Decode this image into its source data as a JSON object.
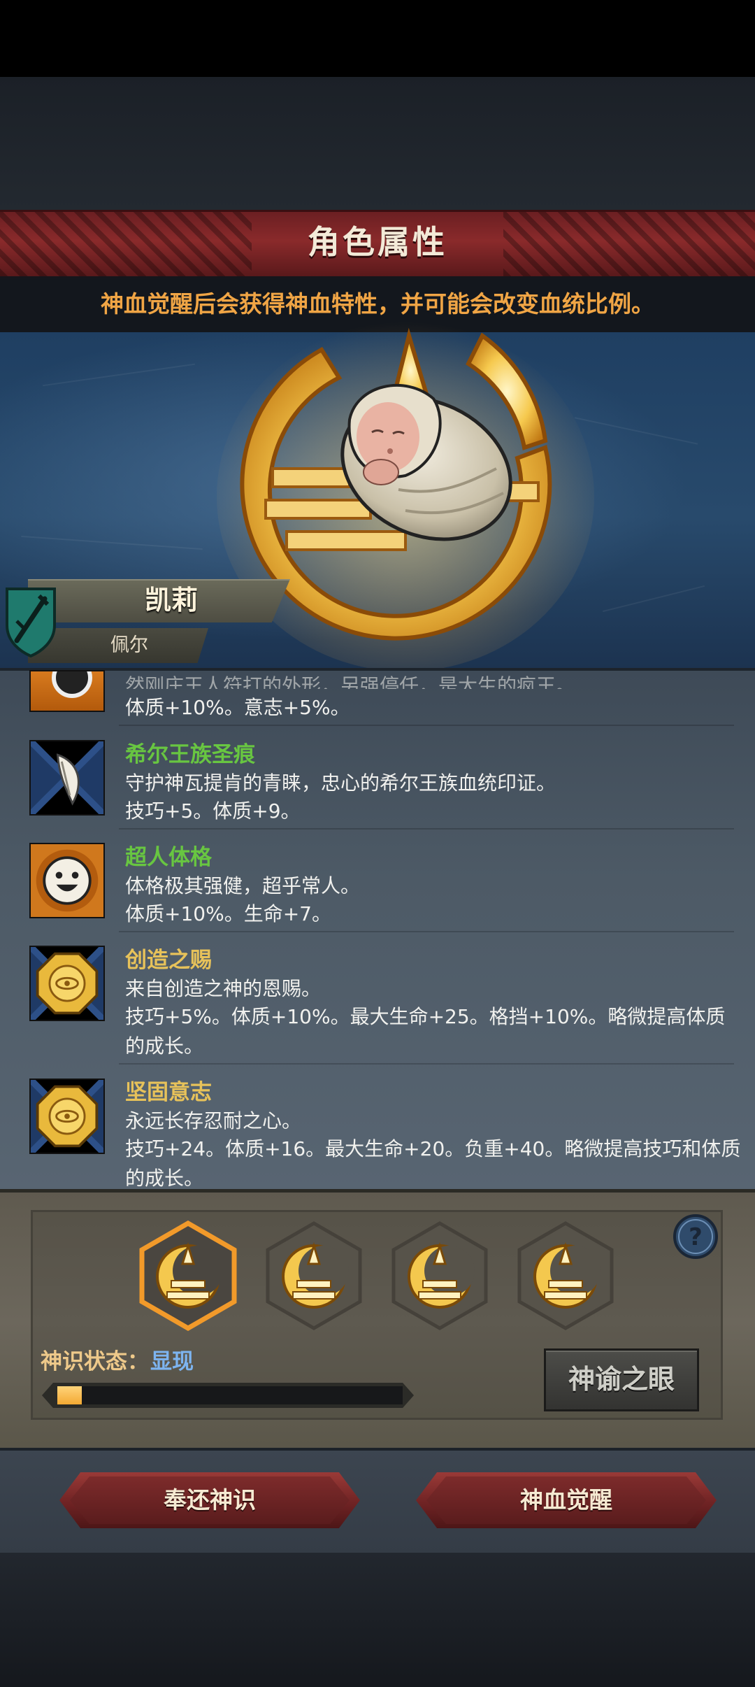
{
  "page": {
    "title": "角色属性"
  },
  "notice": "神血觉醒后会获得神血特性，并可能会改变血统比例。",
  "character": {
    "name": "凯莉",
    "subname": "佩尔",
    "class_icon": "crossed-swords-shield-icon",
    "portrait_icon": "swaddled-baby-icon",
    "emblem_icon": "golden-crescent-emblem-icon"
  },
  "traits": [
    {
      "name": "",
      "icon": "eye-trait-icon",
      "lines": [
        "然刚庄王人符打的外形，另强停任，是大生的疯王。",
        "体质+10%。意志+5%。"
      ]
    },
    {
      "name": "希尔王族圣痕",
      "name_color": "#68c641",
      "icon": "feather-trait-icon",
      "lines": [
        "守护神瓦提肯的青睐，忠心的希尔王族血统印证。",
        "技巧+5。体质+9。"
      ]
    },
    {
      "name": "超人体格",
      "name_color": "#68c641",
      "icon": "smiley-face-icon",
      "lines": [
        "体格极其强健，超乎常人。",
        "体质+10%。生命+7。"
      ]
    },
    {
      "name": "创造之赐",
      "name_color": "#e7c25a",
      "icon": "golden-octagon-seal-icon",
      "lines": [
        "来自创造之神的恩赐。",
        "技巧+5%。体质+10%。最大生命+25。格挡+10%。略微提高体质",
        "的成长。"
      ]
    },
    {
      "name": "坚固意志",
      "name_color": "#e7c25a",
      "icon": "golden-octagon-seal-icon",
      "lines": [
        "永远长存忍耐之心。",
        "技巧+24。体质+16。最大生命+20。负重+40。略微提高技巧和体质",
        "的成长。"
      ]
    }
  ],
  "awakening": {
    "slots": [
      {
        "icon": "divine-emblem-icon",
        "selected": true
      },
      {
        "icon": "divine-emblem-icon",
        "selected": false
      },
      {
        "icon": "divine-emblem-icon",
        "selected": false
      },
      {
        "icon": "divine-emblem-icon",
        "selected": false
      }
    ],
    "status_label": "神识状态：",
    "status_value": "显现",
    "progress": 0.07,
    "oracle_button": "神谕之眼",
    "help_icon": "question-mark-icon"
  },
  "actions": {
    "return_button": "奉还神识",
    "awaken_button": "神血觉醒"
  },
  "colors": {
    "banner": "#7a2527",
    "notice_text": "#f0a545",
    "trait_green": "#68c641",
    "trait_gold": "#e7c25a",
    "status_value": "#7db4f0",
    "progress_fill": "#f3a933"
  }
}
